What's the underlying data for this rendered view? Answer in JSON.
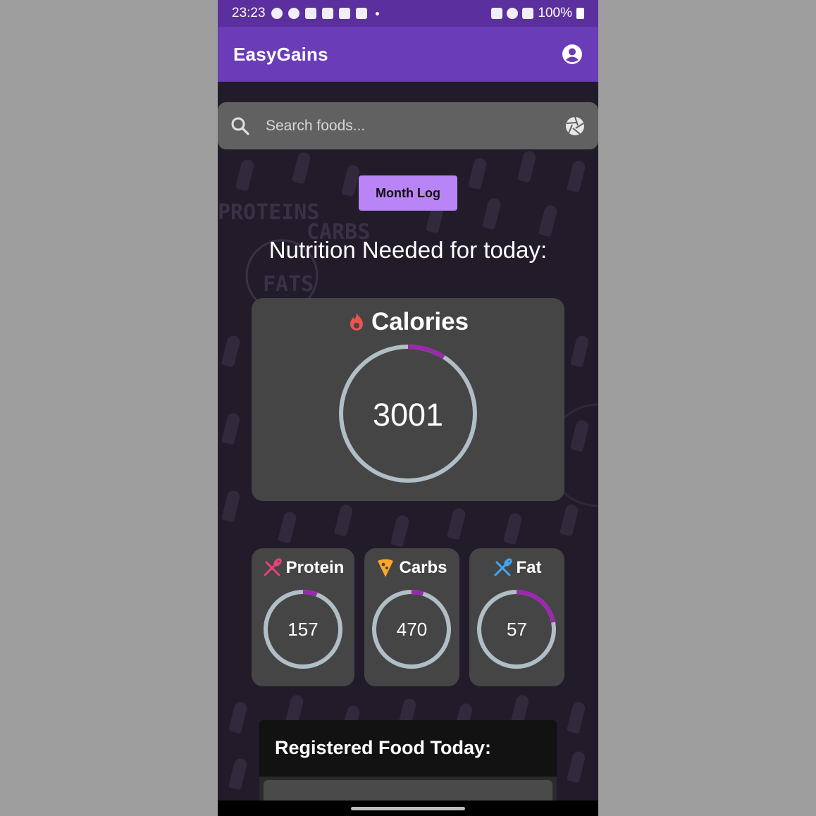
{
  "status_bar": {
    "time": "23:23",
    "battery": "100%"
  },
  "app": {
    "title": "EasyGains"
  },
  "search": {
    "placeholder": "Search foods..."
  },
  "month_log": {
    "label": "Month Log"
  },
  "heading": "Nutrition Needed for today:",
  "background_watermark": {
    "line1": "PROTEINS",
    "line2": "CARBS",
    "line3": "FATS"
  },
  "calories": {
    "label": "Calories",
    "value": "3001",
    "progress": 0.09
  },
  "macros": [
    {
      "label": "Protein",
      "value": "157",
      "progress": 0.06
    },
    {
      "label": "Carbs",
      "value": "470",
      "progress": 0.05
    },
    {
      "label": "Fat",
      "value": "57",
      "progress": 0.22
    }
  ],
  "registered": {
    "title": "Registered Food Today:"
  },
  "colors": {
    "accent": "#9c27b0",
    "track": "#b0bec5",
    "appbar": "#6a3cb8",
    "button": "#b984f5",
    "calorie_icon": "#ef5350",
    "protein_icon": "#ec407a",
    "carbs_icon": "#ffa726",
    "fat_icon": "#42a5f5"
  }
}
